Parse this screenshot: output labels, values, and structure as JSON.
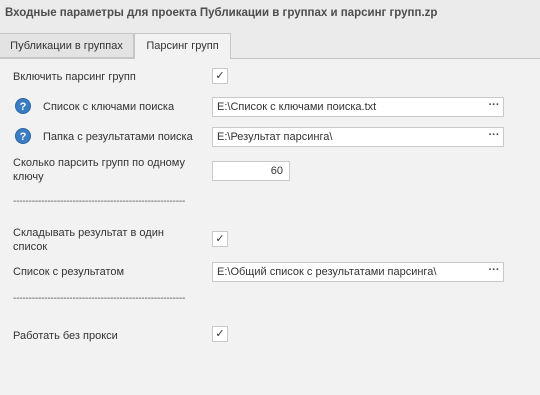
{
  "window": {
    "title": "Входные параметры для проекта Публикации в группах и парсинг групп.zp"
  },
  "tabs": [
    {
      "label": "Публикации в группах",
      "active": false
    },
    {
      "label": "Парсинг групп",
      "active": true
    }
  ],
  "settings": {
    "enable_parsing": {
      "label": "Включить парсинг групп",
      "checked": true,
      "check_glyph": "✓"
    },
    "keys_list": {
      "label": "Список с ключами поиска",
      "value": "E:\\Список с ключами поиска.txt",
      "help_glyph": "?",
      "browse": "···"
    },
    "results_folder": {
      "label": "Папка с результатами поиска",
      "value": "E:\\Результат парсинга\\",
      "help_glyph": "?",
      "browse": "···"
    },
    "groups_per_key": {
      "label_line1": "Сколько парсить групп по одному",
      "label_line2": "ключу",
      "value": "60"
    },
    "separator1": "-------------------------------------------------------",
    "single_list": {
      "label_line1": "Складывать результат в один",
      "label_line2": "список",
      "checked": true,
      "check_glyph": "✓"
    },
    "result_list": {
      "label": "Список с результатом",
      "value": "E:\\Общий список с результатами парсинга\\",
      "browse": "···"
    },
    "separator2": "-------------------------------------------------------",
    "no_proxy": {
      "label": "Работать без прокси",
      "checked": true,
      "check_glyph": "✓"
    }
  },
  "icons": {
    "help": "question-circle-icon",
    "check": "check-icon",
    "browse": "ellipsis-icon"
  },
  "colors": {
    "help_icon_bg": "#3c7cc2",
    "panel_bg": "#f2f2f2",
    "window_bg": "#ebebeb"
  }
}
